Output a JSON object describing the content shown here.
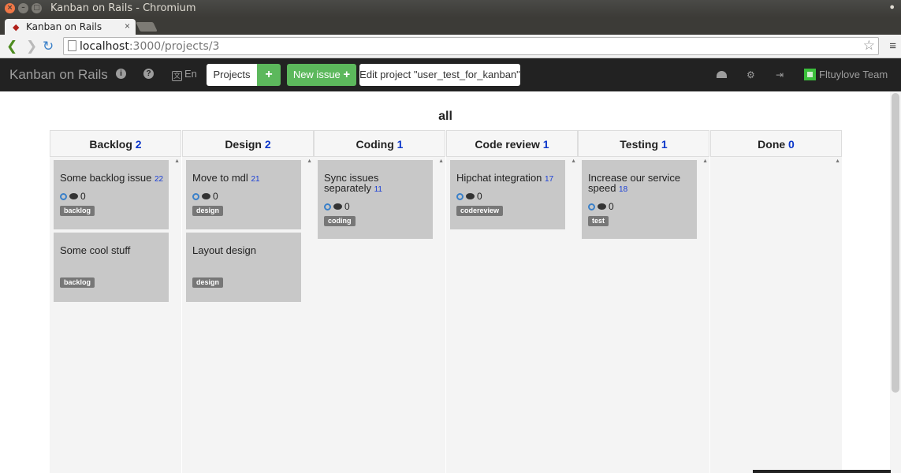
{
  "window": {
    "title": "Kanban on Rails - Chromium",
    "close": "×",
    "minimize": "–",
    "maximize": "□",
    "menu": "●"
  },
  "browser": {
    "tab_label": "Kanban on Rails",
    "tab_close": "×",
    "url_host": "localhost",
    "url_path": ":3000/projects/3",
    "back": "❮",
    "forward": "❯",
    "reload": "↻",
    "star": "☆",
    "menu": "≡",
    "profile": "▲"
  },
  "navbar": {
    "brand": "Kanban on Rails",
    "info_icon": "i",
    "help_icon": "?",
    "language": "En",
    "language_icon": "文",
    "projects_label": "Projects",
    "plus_label": "+",
    "new_issue_label": "New issue",
    "new_issue_plus": "+",
    "edit_project_label": "Edit project \"user_test_for_kanban\"",
    "users_icon": "⚙",
    "logout_icon": "⇥",
    "team_label": "Fltuylove Team"
  },
  "board": {
    "filter_title": "all",
    "comment_count_glyph": "0",
    "columns": [
      {
        "name": "Backlog",
        "count": "2",
        "cards": [
          {
            "title": "Some backlog issue",
            "number": "22",
            "comments": "0",
            "tag": "backlog",
            "has_meta": true
          },
          {
            "title": "Some cool stuff",
            "number": "",
            "comments": "",
            "tag": "backlog",
            "has_meta": false
          }
        ]
      },
      {
        "name": "Design",
        "count": "2",
        "cards": [
          {
            "title": "Move to mdl",
            "number": "21",
            "comments": "0",
            "tag": "design",
            "has_meta": true
          },
          {
            "title": "Layout design",
            "number": "",
            "comments": "",
            "tag": "design",
            "has_meta": false
          }
        ]
      },
      {
        "name": "Coding",
        "count": "1",
        "cards": [
          {
            "title": "Sync issues separately",
            "number": "11",
            "comments": "0",
            "tag": "coding",
            "has_meta": true
          }
        ]
      },
      {
        "name": "Code review",
        "count": "1",
        "cards": [
          {
            "title": "Hipchat integration",
            "number": "17",
            "comments": "0",
            "tag": "codereview",
            "has_meta": true
          }
        ]
      },
      {
        "name": "Testing",
        "count": "1",
        "cards": [
          {
            "title": "Increase our service speed",
            "number": "18",
            "comments": "0",
            "tag": "test",
            "has_meta": true
          }
        ]
      },
      {
        "name": "Done",
        "count": "0",
        "cards": []
      }
    ]
  }
}
